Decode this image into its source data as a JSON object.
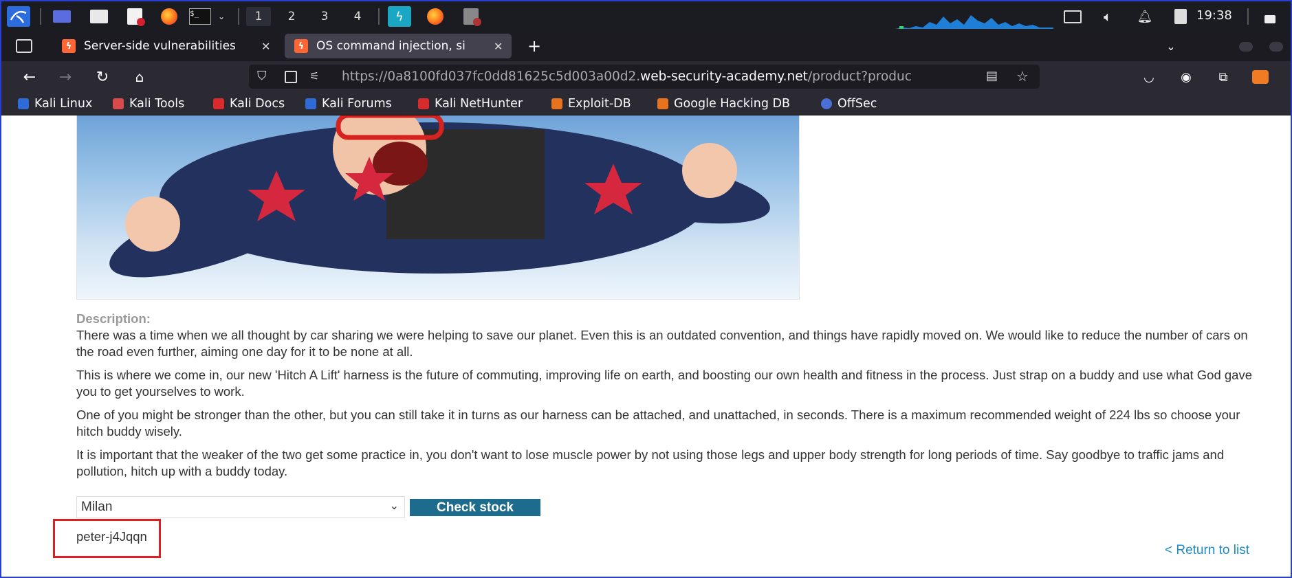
{
  "taskbar": {
    "workspaces": [
      "1",
      "2",
      "3",
      "4"
    ],
    "clock": "19:38"
  },
  "tabs": [
    {
      "title": "Server-side vulnerabilities",
      "active": false
    },
    {
      "title": "OS command injection, si",
      "active": true
    }
  ],
  "nav": {
    "url_prefix": "https://0a8100fd037fc0dd81625c5d003a00d2.",
    "url_domain": "web-security-academy.net",
    "url_suffix": "/product?produc"
  },
  "bookmarks": [
    {
      "label": "Kali Linux",
      "color": "#2f6bd6"
    },
    {
      "label": "Kali Tools",
      "color": "#d94b4b"
    },
    {
      "label": "Kali Docs",
      "color": "#d92b2b"
    },
    {
      "label": "Kali Forums",
      "color": "#2f6bd6"
    },
    {
      "label": "Kali NetHunter",
      "color": "#d92b2b"
    },
    {
      "label": "Exploit-DB",
      "color": "#e8731f"
    },
    {
      "label": "Google Hacking DB",
      "color": "#e8731f"
    },
    {
      "label": "OffSec",
      "color": "#4a6fd6"
    }
  ],
  "product": {
    "description_label": "Description:",
    "paragraphs": [
      "There was a time when we all thought by car sharing we were helping to save our planet. Even this is an outdated convention, and things have rapidly moved on. We would like to reduce the number of cars on the road even further, aiming one day for it to be none at all.",
      "This is where we come in, our new 'Hitch A Lift' harness is the future of commuting, improving life on earth, and boosting our own health and fitness in the process. Just strap on a buddy and use what God gave you to get yourselves to work.",
      "One of you might be stronger than the other, but you can still take it in turns as our harness can be attached, and unattached, in seconds. There is a maximum recommended weight of 224 lbs so choose your hitch buddy wisely.",
      "It is important that the weaker of the two get some practice in, you don't want to lose muscle power by not using those legs and upper body strength for long periods of time. Say goodbye to traffic jams and pollution, hitch up with a buddy today."
    ],
    "store_select": "Milan",
    "check_stock": "Check stock",
    "stock_result": "peter-j4Jqqn",
    "return_link": "< Return to list"
  }
}
